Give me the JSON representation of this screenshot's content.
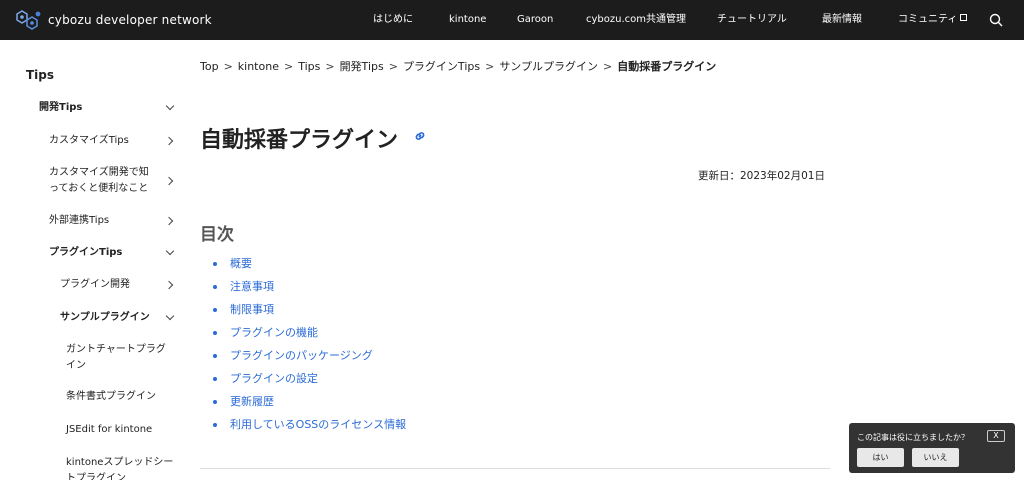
{
  "header": {
    "logo_text": "cybozu developer network",
    "nav": [
      "はじめに",
      "kintone",
      "Garoon",
      "cybozu.com共通管理",
      "チュートリアル",
      "最新情報",
      "コミュニティ"
    ]
  },
  "sidebar": {
    "title": "Tips",
    "items": [
      {
        "label": "開発Tips"
      },
      {
        "label": "カスタマイズTips"
      },
      {
        "label_line1": "カスタマイズ開発で知",
        "label_line2": "っておくと便利なこと"
      },
      {
        "label": "外部連携Tips"
      },
      {
        "label": "プラグインTips"
      },
      {
        "label": "プラグイン開発"
      },
      {
        "label": "サンプルプラグイン"
      },
      {
        "label_line1": "ガントチャートプラグ",
        "label_line2": "イン"
      },
      {
        "label": "条件書式プラグイン"
      },
      {
        "label": "JSEdit for kintone"
      },
      {
        "label_line1": "kintoneスプレッドシー",
        "label_line2": "トプラグイン"
      }
    ]
  },
  "breadcrumb": [
    "Top",
    "kintone",
    "Tips",
    "開発Tips",
    "プラグインTips",
    "サンプルプラグイン",
    "自動採番プラグイン"
  ],
  "page": {
    "title": "自動採番プラグイン",
    "updated": "更新日：2023年02月01日"
  },
  "toc": {
    "heading": "目次",
    "items": [
      "概要",
      "注意事項",
      "制限事項",
      "プラグインの機能",
      "プラグインのパッケージング",
      "プラグインの設定",
      "更新履歴",
      "利用しているOSSのライセンス情報"
    ]
  },
  "feedback": {
    "question": "この記事は役に立ちましたか？",
    "close": "X",
    "yes": "はい",
    "no": "いいえ"
  },
  "colors": {
    "header_bg": "#1c1c1c",
    "link": "#2b6bd6",
    "feedback_bg": "#333333"
  }
}
